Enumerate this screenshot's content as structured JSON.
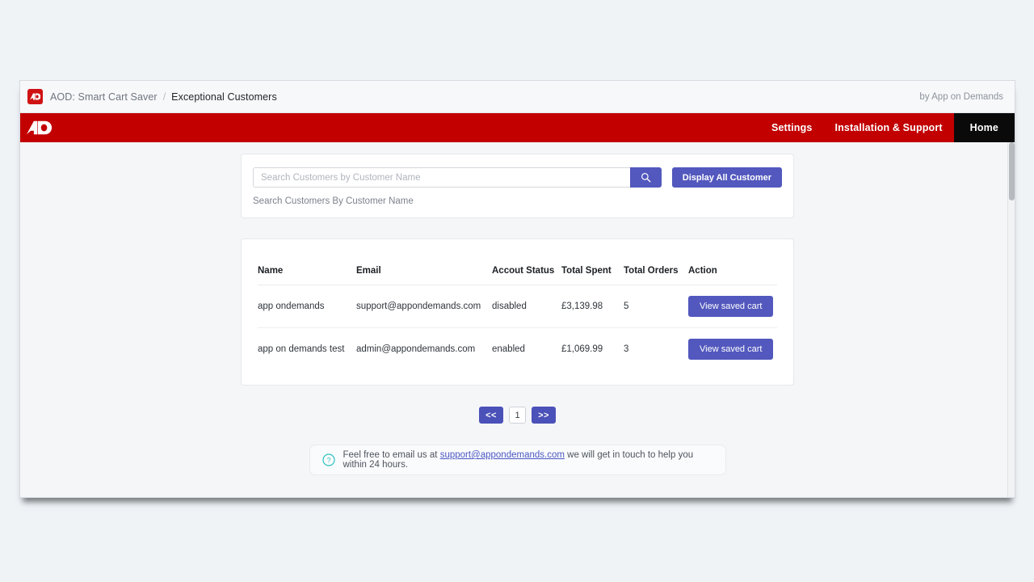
{
  "colors": {
    "brand_red": "#c20000",
    "accent_indigo": "#5258bd",
    "home_black": "#0a0a0a",
    "page_bg": "#eff3f6",
    "help_teal": "#2bbfc0"
  },
  "breadcrumb": {
    "logo_text": "AD",
    "app_name": "AOD: Smart Cart Saver",
    "separator": "/",
    "page_title": "Exceptional Customers",
    "attribution": "by App on Demands"
  },
  "navbar": {
    "logo_text": "AD",
    "links": [
      {
        "label": "Settings",
        "active": false
      },
      {
        "label": "Installation & Support",
        "active": false
      },
      {
        "label": "Home",
        "active": true
      }
    ]
  },
  "search": {
    "placeholder": "Search Customers by Customer Name",
    "value": "",
    "search_icon": "search-icon",
    "display_all_label": "Display All Customer",
    "helper_text": "Search Customers By Customer Name"
  },
  "table": {
    "columns": [
      "Name",
      "Email",
      "Accout Status",
      "Total Spent",
      "Total Orders",
      "Action"
    ],
    "rows": [
      {
        "name": "app ondemands",
        "email": "support@appondemands.com",
        "status": "disabled",
        "total_spent": "£3,139.98",
        "total_orders": "5",
        "action_label": "View saved cart"
      },
      {
        "name": "app on demands test",
        "email": "admin@appondemands.com",
        "status": "enabled",
        "total_spent": "£1,069.99",
        "total_orders": "3",
        "action_label": "View saved cart"
      }
    ]
  },
  "pagination": {
    "prev_label": "<<",
    "current_page": "1",
    "next_label": ">>"
  },
  "footer": {
    "icon": "question-circle-icon",
    "text_before": "Feel free to email us at",
    "email": "support@appondemands.com",
    "text_after": "we will get in touch to help you within 24 hours."
  }
}
